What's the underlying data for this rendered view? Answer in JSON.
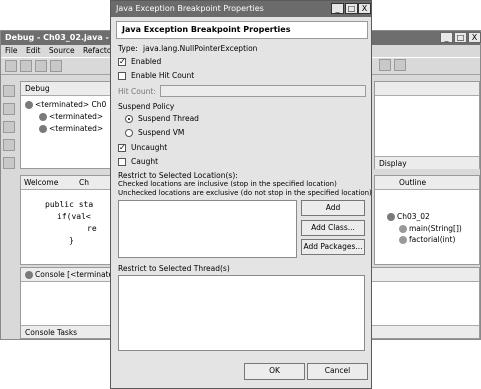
{
  "background_window": {
    "title": "Debug - Ch03_02.java - Ec",
    "menu": [
      "File",
      "Edit",
      "Source",
      "Refactor"
    ],
    "window_buttons": [
      "_",
      "□",
      "X"
    ],
    "debug_view": {
      "tab": "Debug",
      "items": [
        "<terminated> Ch0",
        "<terminated>",
        "<terminated>"
      ]
    },
    "right_panel_tab": "Display",
    "editor_tabs": [
      "Welcome",
      "Ch"
    ],
    "code_lines": [
      "public sta",
      "if(val<",
      "re",
      "}"
    ],
    "outline": {
      "tab": "Outline",
      "class_name": "Ch03_02",
      "methods": [
        "main(String[])",
        "factorial(int)"
      ]
    },
    "console_tab": "Console [<terminate",
    "bottom_tabs": [
      "Console",
      "Tasks"
    ]
  },
  "dialog": {
    "title": "Java Exception Breakpoint Properties",
    "window_buttons": [
      "_",
      "□",
      "X"
    ],
    "header": "Java Exception Breakpoint Properties",
    "type_label": "Type:",
    "type_value": "java.lang.NullPointerException",
    "enabled_label": "Enabled",
    "enabled_checked": true,
    "hit_count_enable_label": "Enable Hit Count",
    "hit_count_enable_checked": false,
    "hit_count_label": "Hit Count:",
    "hit_count_value": "",
    "suspend_policy_label": "Suspend Policy",
    "suspend_thread_label": "Suspend Thread",
    "suspend_vm_label": "Suspend VM",
    "suspend_selected": "Suspend Thread",
    "uncaught_label": "Uncaught",
    "uncaught_checked": true,
    "caught_label": "Caught",
    "caught_checked": false,
    "restrict_locations_label": "Restrict to Selected Location(s):",
    "checked_note": "Checked locations are inclusive (stop in the specified location)",
    "unchecked_note": "Unchecked locations are exclusive (do not stop in the specified location)",
    "add_button": "Add",
    "add_class_button": "Add Class...",
    "add_packages_button": "Add Packages...",
    "restrict_threads_label": "Restrict to Selected Thread(s)",
    "ok_button": "OK",
    "cancel_button": "Cancel"
  }
}
